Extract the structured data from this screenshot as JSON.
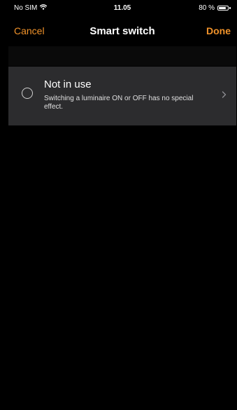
{
  "status_bar": {
    "carrier": "No SIM",
    "time": "11.05",
    "battery_percent": "80 %",
    "battery_level": 0.8,
    "wifi_icon": "wifi-icon"
  },
  "nav": {
    "cancel_label": "Cancel",
    "title": "Smart switch",
    "done_label": "Done"
  },
  "options": [
    {
      "title": "Not in use",
      "subtitle": "Switching a luminaire ON or OFF has no special effect.",
      "selected": false
    }
  ],
  "colors": {
    "accent": "#f0922a",
    "background": "#000000",
    "row_background": "#2c2c2e",
    "band_background": "#0a0a0a"
  }
}
